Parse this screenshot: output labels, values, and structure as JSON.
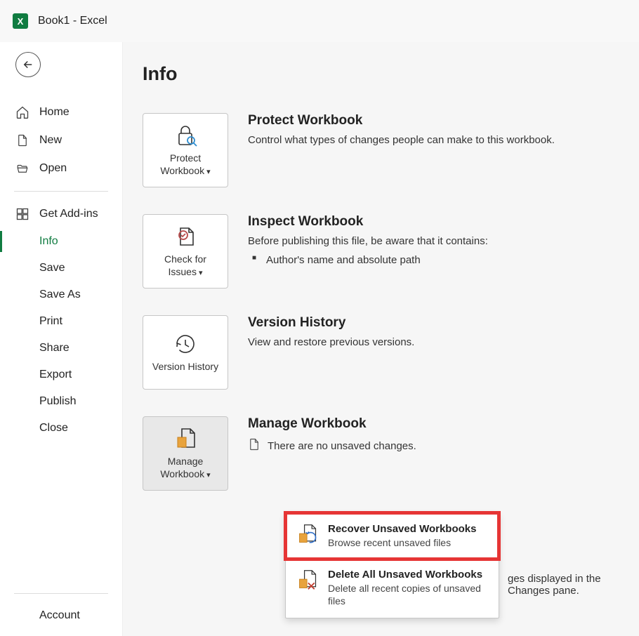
{
  "titlebar": {
    "title": "Book1  -  Excel"
  },
  "sidebar": {
    "home": "Home",
    "new": "New",
    "open": "Open",
    "addins": "Get Add-ins",
    "info": "Info",
    "save": "Save",
    "saveas": "Save As",
    "print": "Print",
    "share": "Share",
    "export": "Export",
    "publish": "Publish",
    "close": "Close",
    "account": "Account"
  },
  "page": {
    "title": "Info"
  },
  "protect": {
    "tile": "Protect Workbook",
    "heading": "Protect Workbook",
    "desc": "Control what types of changes people can make to this workbook."
  },
  "inspect": {
    "tile": "Check for Issues",
    "heading": "Inspect Workbook",
    "desc": "Before publishing this file, be aware that it contains:",
    "bullet1": "Author's name and absolute path"
  },
  "version": {
    "tile": "Version History",
    "heading": "Version History",
    "desc": "View and restore previous versions."
  },
  "manage": {
    "tile": "Manage Workbook",
    "heading": "Manage Workbook",
    "nochanges": "There are no unsaved changes."
  },
  "dropdown": {
    "recover_title": "Recover Unsaved Workbooks",
    "recover_sub": "Browse recent unsaved files",
    "delete_title": "Delete All Unsaved Workbooks",
    "delete_sub": "Delete all recent copies of unsaved files"
  },
  "showchanges_tail": "ges displayed in the Changes pane."
}
